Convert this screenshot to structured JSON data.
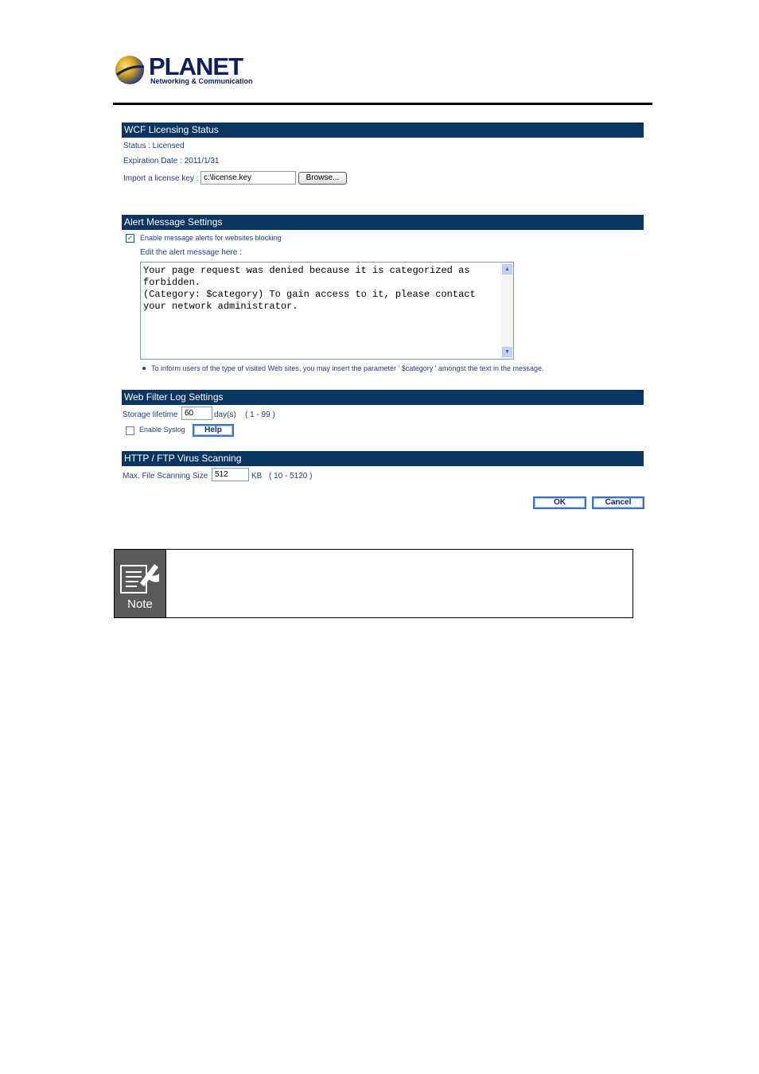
{
  "header": {
    "brand": "PLANET",
    "tagline": "Networking & Communication"
  },
  "wcf": {
    "title": "WCF Licensing Status",
    "status": "Status : Licensed",
    "expiration": "Expiration Date : 2011/1/31",
    "import_label": "Import a license key :",
    "license_path": "c:\\license.key",
    "browse_label": "Browse..."
  },
  "alert": {
    "title": "Alert Message Settings",
    "enable_label": "Enable message alerts for websites blocking",
    "enabled": true,
    "edit_label": "Edit the alert message here :",
    "message": "Your page request was denied because it is categorized as\nforbidden.\n(Category: $category) To gain access to it, please contact\nyour network administrator.",
    "hint": "To inform users of the type of visited Web sites, you may insert the parameter ' $category ' amongst the text in the message."
  },
  "log": {
    "title": "Web Filter Log Settings",
    "storage_label": "Storage lifetime",
    "storage_value": "60",
    "storage_unit": "day(s)",
    "storage_range": "( 1 - 99 )",
    "syslog_label": "Enable Syslog",
    "syslog_enabled": false,
    "help_label": "Help"
  },
  "virus": {
    "title": "HTTP / FTP Virus Scanning",
    "size_label": "Max. File Scanning Size",
    "size_value": "512",
    "size_unit": "KB",
    "size_range": "( 10 - 5120 )"
  },
  "actions": {
    "ok_label": "OK",
    "cancel_label": "Cancel"
  },
  "note": {
    "label": "Note"
  }
}
